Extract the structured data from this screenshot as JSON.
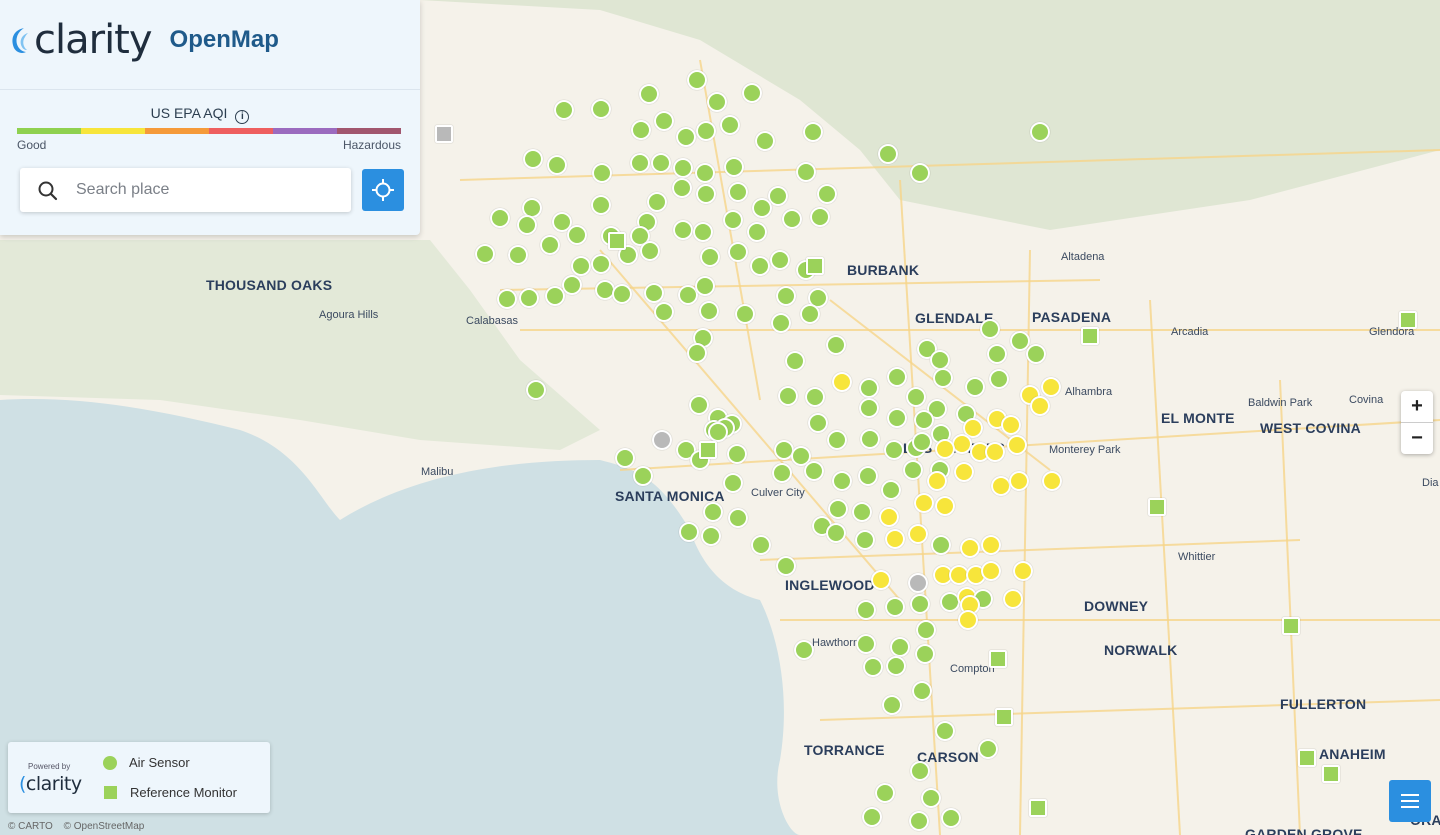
{
  "brand": {
    "name": "clarity",
    "product": "OpenMap"
  },
  "aqi": {
    "title": "US EPA AQI",
    "low_label": "Good",
    "high_label": "Hazardous",
    "scale_colors": [
      "#8fd14f",
      "#f7e53b",
      "#f59a3a",
      "#ee5f5f",
      "#9b6bbf",
      "#a1566e"
    ]
  },
  "search": {
    "placeholder": "Search place"
  },
  "zoom": {
    "in_label": "+",
    "out_label": "−"
  },
  "legend": {
    "powered_by": "Powered by",
    "logo_text": "clarity",
    "air_sensor": "Air Sensor",
    "reference_monitor": "Reference Monitor"
  },
  "attribution": [
    "© CARTO",
    "© OpenStreetMap"
  ],
  "colors": {
    "good": "#9bd25a",
    "moderate": "#f7e53b",
    "offline": "#b9b9b9",
    "accent": "#2b8fe0"
  },
  "places": [
    {
      "name": "THOUSAND OAKS",
      "size": "big"
    },
    {
      "name": "Agoura Hills",
      "size": "small"
    },
    {
      "name": "Calabasas",
      "size": "small"
    },
    {
      "name": "BURBANK",
      "size": "big"
    },
    {
      "name": "GLENDALE",
      "size": "big"
    },
    {
      "name": "PASADENA",
      "size": "big"
    },
    {
      "name": "Altadena",
      "size": "small"
    },
    {
      "name": "Arcadia",
      "size": "small"
    },
    {
      "name": "Glendora",
      "size": "small"
    },
    {
      "name": "Alhambra",
      "size": "small"
    },
    {
      "name": "EL MONTE",
      "size": "big"
    },
    {
      "name": "Baldwin Park",
      "size": "small"
    },
    {
      "name": "Covina",
      "size": "small"
    },
    {
      "name": "WEST COVINA",
      "size": "big"
    },
    {
      "name": "LOS ANGELES",
      "size": "big"
    },
    {
      "name": "Monterey Park",
      "size": "small"
    },
    {
      "name": "Malibu",
      "size": "small"
    },
    {
      "name": "SANTA MONICA",
      "size": "big"
    },
    {
      "name": "Culver City",
      "size": "small"
    },
    {
      "name": "INGLEWOOD",
      "size": "big"
    },
    {
      "name": "DOWNEY",
      "size": "big"
    },
    {
      "name": "Whittier",
      "size": "small"
    },
    {
      "name": "Hawthorne",
      "size": "small"
    },
    {
      "name": "Compton",
      "size": "small"
    },
    {
      "name": "NORWALK",
      "size": "big"
    },
    {
      "name": "FULLERTON",
      "size": "big"
    },
    {
      "name": "TORRANCE",
      "size": "big"
    },
    {
      "name": "CARSON",
      "size": "big"
    },
    {
      "name": "ANAHEIM",
      "size": "big"
    },
    {
      "name": "ORANGE",
      "size": "big"
    },
    {
      "name": "GARDEN GROVE",
      "size": "big"
    },
    {
      "name": "Dia",
      "size": "small"
    }
  ]
}
